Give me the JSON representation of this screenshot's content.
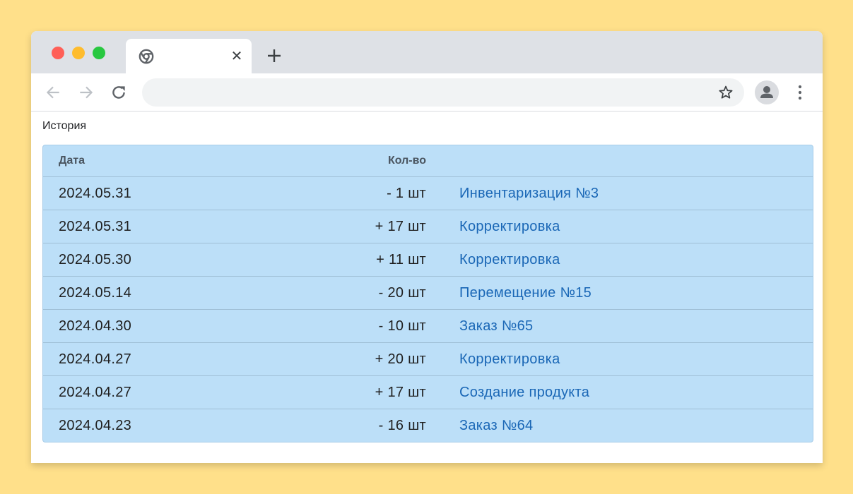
{
  "browser": {
    "tab_title": "",
    "tab_close_glyph": "✕",
    "address_value": "",
    "address_placeholder": ""
  },
  "page": {
    "title": "История"
  },
  "table": {
    "columns": {
      "date": "Дата",
      "qty": "Кол-во",
      "doc": ""
    },
    "rows": [
      {
        "date": "2024.05.31",
        "qty": "- 1 шт",
        "doc": "Инвентаризация №3"
      },
      {
        "date": "2024.05.31",
        "qty": "+ 17 шт",
        "doc": "Корректировка"
      },
      {
        "date": "2024.05.30",
        "qty": "+ 11 шт",
        "doc": "Корректировка"
      },
      {
        "date": "2024.05.14",
        "qty": "- 20 шт",
        "doc": "Перемещение №15"
      },
      {
        "date": "2024.04.30",
        "qty": "- 10 шт",
        "doc": "Заказ №65"
      },
      {
        "date": "2024.04.27",
        "qty": "+ 20 шт",
        "doc": "Корректировка"
      },
      {
        "date": "2024.04.27",
        "qty": "+ 17 шт",
        "doc": "Создание продукта"
      },
      {
        "date": "2024.04.23",
        "qty": "- 16 шт",
        "doc": "Заказ №64"
      }
    ]
  },
  "icons": {
    "favicon": "chrome-icon",
    "close": "close-icon",
    "new_tab": "plus-icon",
    "back": "arrow-left-icon",
    "forward": "arrow-right-icon",
    "reload": "reload-icon",
    "bookmark": "star-icon",
    "profile": "person-icon",
    "menu": "kebab-menu-icon"
  },
  "colors": {
    "page_background": "#FFE08A",
    "table_background": "#BCDFF8",
    "link": "#1A67B6",
    "traffic_red": "#FF5F57",
    "traffic_yellow": "#FEBC2E",
    "traffic_green": "#28C840"
  }
}
